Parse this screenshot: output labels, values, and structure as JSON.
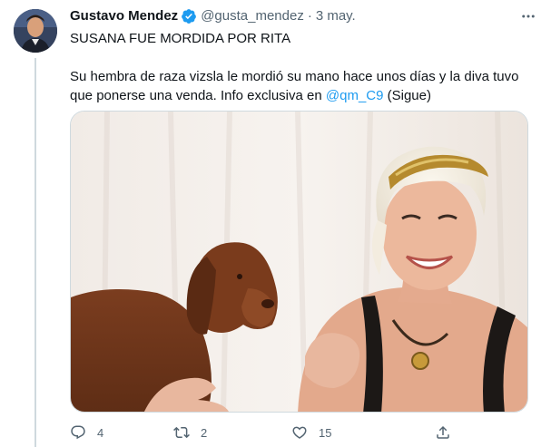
{
  "tweet": {
    "author": {
      "display_name": "Gustavo Mendez",
      "handle": "@gusta_mendez",
      "verified": true,
      "avatar_icon": "user-avatar"
    },
    "separator": "·",
    "date": "3 may.",
    "more_icon": "more-horizontal-icon",
    "headline": "SUSANA FUE MORDIDA POR RITA",
    "body_before_mention": "Su hembra de raza vizsla le mordió su mano hace unos días y la diva tuvo que ponerse una venda. Info exclusiva en ",
    "mention": "@qm_C9",
    "body_after_mention": " (Sigue)",
    "media": {
      "type": "photo",
      "description_icon": "photo"
    },
    "actions": {
      "reply_count": "4",
      "retweet_count": "2",
      "like_count": "15",
      "share_label": ""
    }
  },
  "colors": {
    "accent": "#1d9bf0",
    "text": "#0f1419",
    "secondary": "#536471",
    "border": "#cfd9de"
  }
}
